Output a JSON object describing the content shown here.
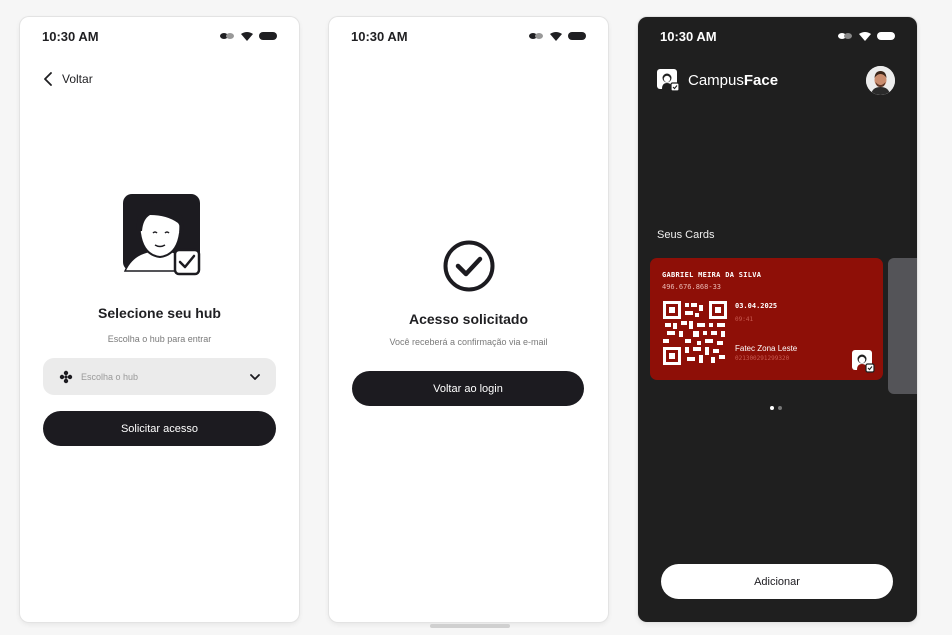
{
  "colors": {
    "dark_button": "#1c1b20",
    "card_red": "#8e0f07",
    "dark_bg": "#1f1f1f"
  },
  "screen_hub": {
    "status_time": "10:30 AM",
    "back_label": "Voltar",
    "title": "Selecione seu hub",
    "subtitle": "Escolha o hub para entrar",
    "select_placeholder": "Escolha o hub",
    "button_label": "Solicitar acesso"
  },
  "screen_confirm": {
    "status_time": "10:30 AM",
    "title": "Acesso solicitado",
    "subtitle": "Você receberá a confirmação via e-mail",
    "button_label": "Voltar ao login"
  },
  "screen_cards": {
    "status_time": "10:30 AM",
    "brand_regular": "Campus",
    "brand_bold": "Face",
    "section_label": "Seus Cards",
    "card": {
      "name": "GABRIEL MEIRA DA SILVA",
      "cpf": "496.676.868-33",
      "date": "03.04.2025",
      "time": "09:41",
      "school": "Fatec Zona Leste",
      "ra": "021300291299320"
    },
    "pagination": {
      "current": 1,
      "total": 2
    },
    "button_label": "Adicionar"
  }
}
